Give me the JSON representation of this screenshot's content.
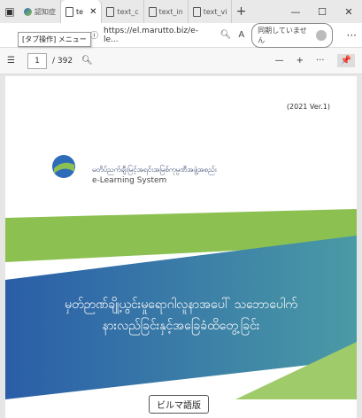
{
  "browser": {
    "tabs": [
      {
        "label": "認知症"
      },
      {
        "label": "te"
      },
      {
        "label": "text_c"
      },
      {
        "label": "text_in"
      },
      {
        "label": "text_vi"
      }
    ],
    "new_tab": "+",
    "tooltip": "[タブ操作] メニュー",
    "url": "https://el.marutto.biz/e-le...",
    "sync_label": "同期していません",
    "more": "···"
  },
  "pdf_toolbar": {
    "page_current": "1",
    "page_total": "/ 392",
    "zoom_out": "—",
    "zoom_in": "+",
    "more": "···"
  },
  "document": {
    "version": "(2021 Ver.1)",
    "org_name": "မတိပ်ညက်ချီးမြင့်အရင်းအမြစ်ကုမ္ပဏီအဖွဲ့အစည်း",
    "elearning": "e-Learning System",
    "title_line1": "မှတ်ဉာဏ်ချို့ယွင်းမှုရောဂါလူနာအပေါ် သဘောပေါက်",
    "title_line2": "နားလည်ခြင်းနှင့်အခြေခံထိတွေ့ခြင်း",
    "lang_button": "ビルマ語版"
  },
  "colors": {
    "band_blue_dark": "#2a5ea8",
    "band_teal": "#4a9aa6",
    "band_green": "#8cc152"
  }
}
